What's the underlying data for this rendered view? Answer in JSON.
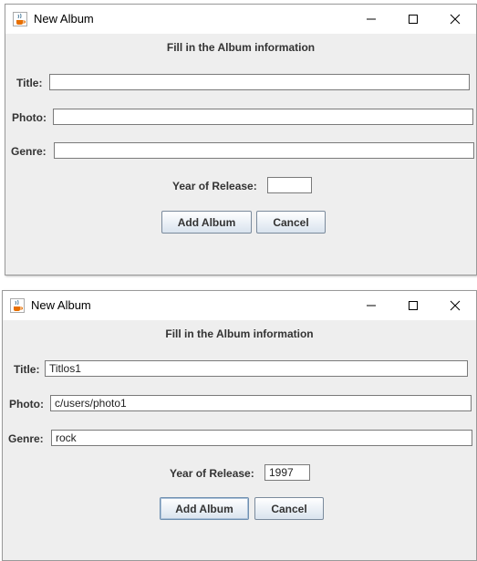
{
  "windows": [
    {
      "title": "New Album",
      "heading": "Fill in the Album information",
      "fields": {
        "title": {
          "label": "Title:",
          "value": ""
        },
        "photo": {
          "label": "Photo:",
          "value": ""
        },
        "genre": {
          "label": "Genre:",
          "value": ""
        },
        "year": {
          "label": "Year of Release:",
          "value": ""
        }
      },
      "buttons": {
        "add": "Add Album",
        "cancel": "Cancel"
      }
    },
    {
      "title": "New Album",
      "heading": "Fill in the Album information",
      "fields": {
        "title": {
          "label": "Title:",
          "value": "Titlos1"
        },
        "photo": {
          "label": "Photo:",
          "value": "c/users/photo1"
        },
        "genre": {
          "label": "Genre:",
          "value": "rock"
        },
        "year": {
          "label": "Year of Release:",
          "value": "1997"
        }
      },
      "buttons": {
        "add": "Add Album",
        "cancel": "Cancel"
      }
    }
  ],
  "icons": {
    "app": "java-coffee-cup-icon",
    "minimize": "minimize-icon",
    "maximize": "maximize-icon",
    "close": "close-icon"
  }
}
